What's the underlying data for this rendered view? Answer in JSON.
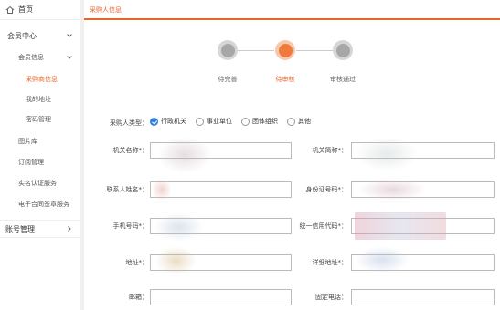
{
  "sidebar": {
    "home": "首页",
    "member_center": "会员中心",
    "member_info": "会员信息",
    "items": [
      {
        "label": "采购商信息",
        "active": true
      },
      {
        "label": "我的地址",
        "active": false
      },
      {
        "label": "密码管理",
        "active": false
      }
    ],
    "l2": [
      "图片库",
      "订阅管理",
      "实名认证服务",
      "电子合同签章服务"
    ],
    "account": "账号管理"
  },
  "tab": {
    "label": "采购人信息"
  },
  "steps": [
    {
      "label": "待完善",
      "state": "done"
    },
    {
      "label": "待审核",
      "state": "active"
    },
    {
      "label": "审核通过",
      "state": "pending"
    }
  ],
  "form": {
    "buyer_type_label": "采购人类型：",
    "buyer_types": [
      {
        "label": "行政机关",
        "checked": true
      },
      {
        "label": "事业单位",
        "checked": false
      },
      {
        "label": "团体组织",
        "checked": false
      },
      {
        "label": "其他",
        "checked": false
      }
    ],
    "org_name_label": "机关名称*：",
    "org_short_label": "机关简称*：",
    "contact_name_label": "联系人姓名*：",
    "id_number_label": "身份证号码*：",
    "phone_label": "手机号码*：",
    "credit_code_label": "统一信用代码*：",
    "address_label": "地址*：",
    "detail_address_label": "详细地址*：",
    "email_label": "邮箱：",
    "fixed_phone_label": "固定电话："
  },
  "colors": {
    "accent": "#e8652a",
    "radio_checked": "#2f7fd8"
  }
}
